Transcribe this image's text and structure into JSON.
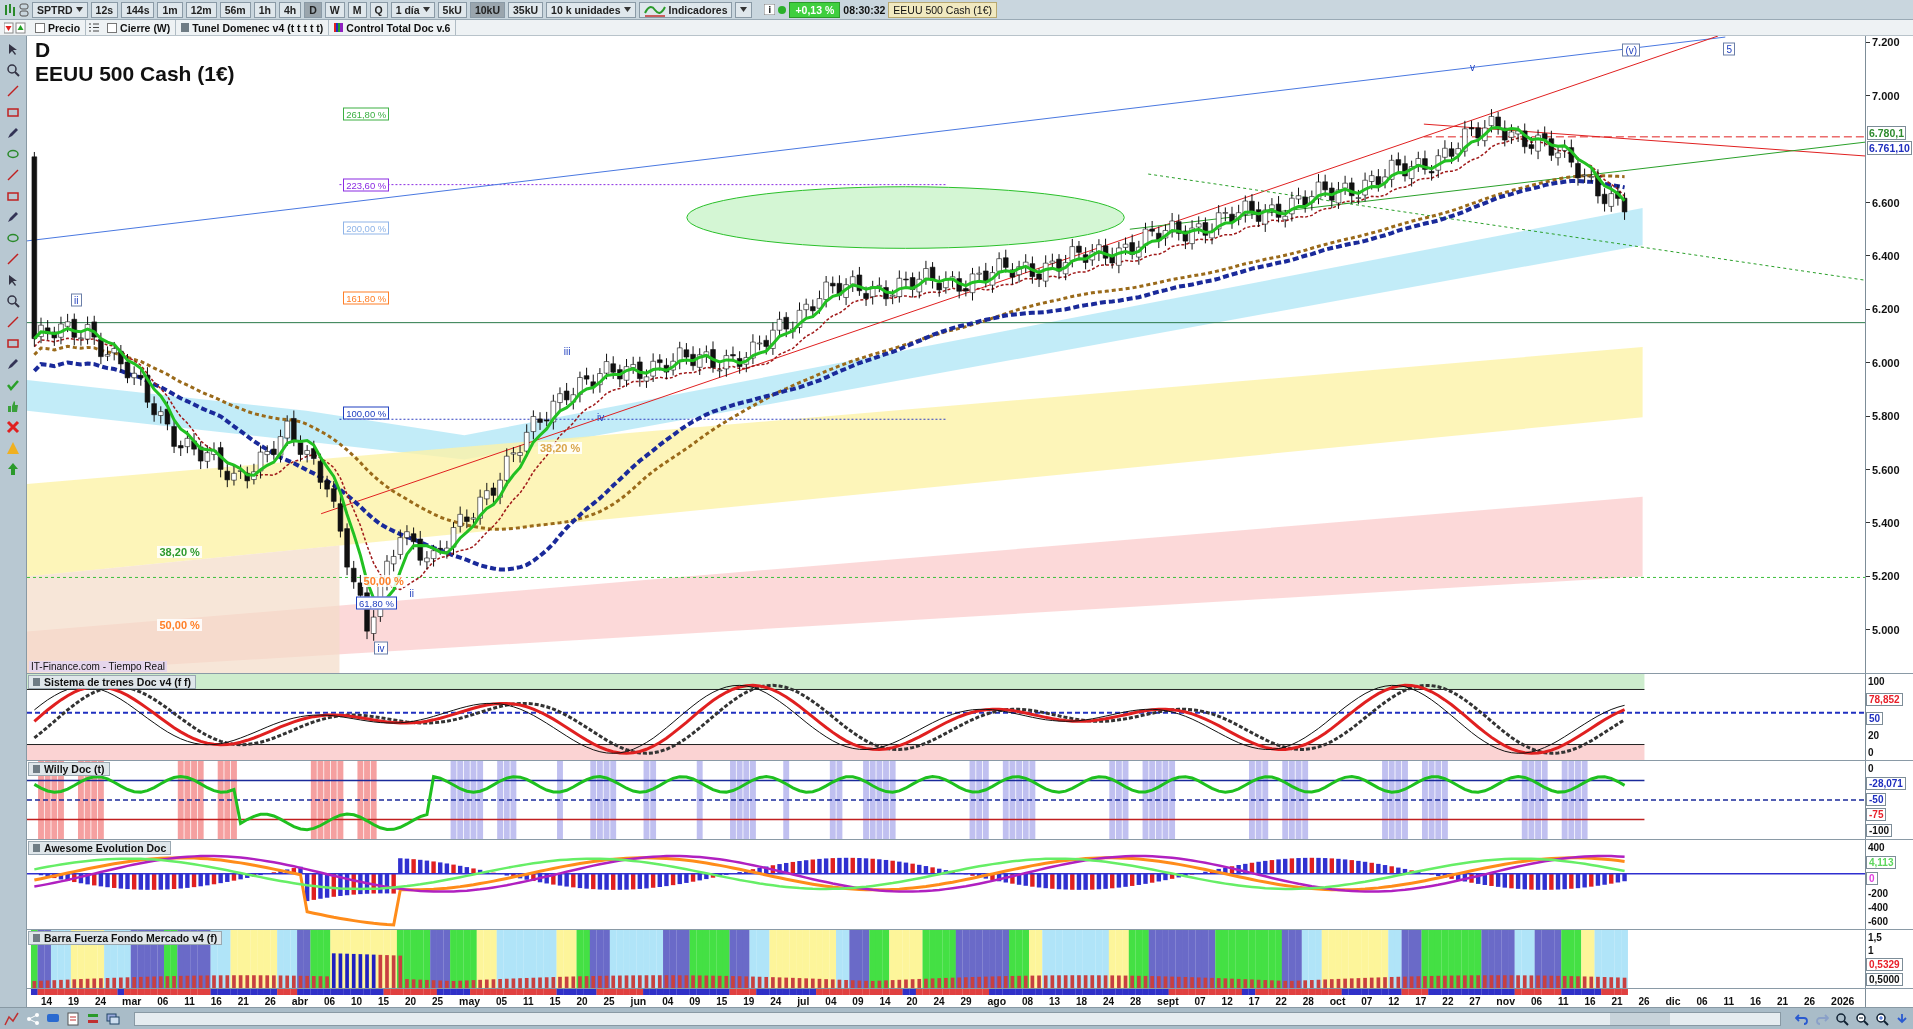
{
  "toolbar": {
    "symbol": "SPTRD",
    "timeframes": [
      {
        "label": "12s",
        "selected": false
      },
      {
        "label": "144s",
        "selected": false
      },
      {
        "label": "1m",
        "selected": false
      },
      {
        "label": "12m",
        "selected": false
      },
      {
        "label": "56m",
        "selected": false
      },
      {
        "label": "1h",
        "selected": false
      },
      {
        "label": "4h",
        "selected": false
      },
      {
        "label": "D",
        "selected": true
      },
      {
        "label": "W",
        "selected": false
      },
      {
        "label": "M",
        "selected": false
      },
      {
        "label": "Q",
        "selected": false
      }
    ],
    "period": "1 día",
    "units": [
      {
        "label": "5kU",
        "selected": false
      },
      {
        "label": "10kU",
        "selected": true
      },
      {
        "label": "35kU",
        "selected": false
      }
    ],
    "units_select": "10 k unidades",
    "indicators_button": "Indicadores",
    "change": "+0,13 %",
    "time": "08:30:32",
    "instrument": "EEUU 500 Cash (1€)"
  },
  "legend": [
    {
      "kind": "checkbox",
      "label": "Precio",
      "checked": false
    },
    {
      "kind": "checkbox",
      "label": "Cierre (W)",
      "checked": false
    },
    {
      "kind": "swatch",
      "label": "Tunel Domenec v4 (t t t t t)"
    },
    {
      "kind": "multicolor",
      "label": "Control Total Doc v.6"
    }
  ],
  "main_chart": {
    "timeframe_label": "D",
    "title": "EEUU 500 Cash (1€)",
    "source": "IT-Finance.com - Tiempo Real",
    "fib_labels": [
      {
        "text": "261,80 %",
        "color": "#3cb043",
        "boxed": true
      },
      {
        "text": "223,60 %",
        "color": "#8a2be2",
        "boxed": true
      },
      {
        "text": "200,00 %",
        "color": "#8fb4e8",
        "boxed": true
      },
      {
        "text": "161,80 %",
        "color": "#ff7f27",
        "boxed": true
      },
      {
        "text": "100,00 %",
        "color": "#1f3fbf",
        "boxed": true
      },
      {
        "text": "61,80 %",
        "color": "#1f3fbf",
        "boxed": true
      },
      {
        "text": "38,20 %",
        "color": "#2e9a2e",
        "boxed": false
      },
      {
        "text": "50,00 %",
        "color": "#ff7f27",
        "boxed": false
      },
      {
        "text": "50,00 %",
        "color": "#ff7f27",
        "boxed": false
      },
      {
        "text": "38,20 %",
        "color": "#d9a54a",
        "boxed": false
      }
    ],
    "wave_labels": [
      {
        "text": "ii",
        "boxed": true
      },
      {
        "text": "iii",
        "boxed": false
      },
      {
        "text": "iv",
        "boxed": false
      },
      {
        "text": "iv",
        "boxed": true
      },
      {
        "text": "ii",
        "boxed": false
      },
      {
        "text": "v",
        "boxed": false
      },
      {
        "text": "(v)",
        "boxed": true
      },
      {
        "text": "5",
        "boxed": true
      }
    ],
    "price_axis": [
      "7.200",
      "7.000",
      "6.600",
      "6.400",
      "6.200",
      "6.000",
      "5.800",
      "5.600",
      "5.400",
      "5.200",
      "5.000"
    ],
    "price_tags": [
      {
        "text": "6.780,1",
        "color": "#2e8b2e"
      },
      {
        "text": "6.761,10",
        "color": "#1f2fbf"
      }
    ]
  },
  "indicators": [
    {
      "kind": "trains",
      "title": "Sistema de trenes Doc v4 (f f)",
      "axis": [
        {
          "text": "100"
        },
        {
          "text": "78,852",
          "color": "#e8202a"
        },
        {
          "text": "50",
          "color": "#1f2fbf"
        },
        {
          "text": "20"
        },
        {
          "text": "0"
        }
      ]
    },
    {
      "kind": "willy",
      "title": "Willy Doc (t)",
      "axis": [
        {
          "text": "0"
        },
        {
          "text": "-28,071",
          "color": "#1f2fbf"
        },
        {
          "text": "-50",
          "color": "#1f2fbf"
        },
        {
          "text": "-75",
          "color": "#e8202a"
        },
        {
          "text": "-100",
          "color": "#111111"
        }
      ]
    },
    {
      "kind": "awesome",
      "title": "Awesome Evolution Doc",
      "axis": [
        {
          "text": "400"
        },
        {
          "text": "4,113",
          "color": "#5cd65c"
        },
        {
          "text": "0",
          "color": "#e040e0"
        },
        {
          "text": "-200"
        },
        {
          "text": "-400"
        },
        {
          "text": "-600"
        }
      ]
    },
    {
      "kind": "strength",
      "title": "Barra Fuerza Fondo Mercado v4 (f)",
      "axis": [
        {
          "text": "1,5"
        },
        {
          "text": "1"
        },
        {
          "text": "0,5329",
          "color": "#e8202a"
        },
        {
          "text": "0,5000",
          "color": "#111111"
        }
      ]
    }
  ],
  "date_axis": [
    {
      "text": "14",
      "kind": "day"
    },
    {
      "text": "19",
      "kind": "day"
    },
    {
      "text": "24",
      "kind": "day"
    },
    {
      "text": "mar",
      "kind": "month"
    },
    {
      "text": "06",
      "kind": "day"
    },
    {
      "text": "11",
      "kind": "day"
    },
    {
      "text": "16",
      "kind": "day"
    },
    {
      "text": "21",
      "kind": "day"
    },
    {
      "text": "26",
      "kind": "day"
    },
    {
      "text": "abr",
      "kind": "month"
    },
    {
      "text": "06",
      "kind": "day"
    },
    {
      "text": "10",
      "kind": "day"
    },
    {
      "text": "15",
      "kind": "day"
    },
    {
      "text": "20",
      "kind": "day"
    },
    {
      "text": "25",
      "kind": "day"
    },
    {
      "text": "may",
      "kind": "month"
    },
    {
      "text": "05",
      "kind": "day"
    },
    {
      "text": "11",
      "kind": "day"
    },
    {
      "text": "15",
      "kind": "day"
    },
    {
      "text": "20",
      "kind": "day"
    },
    {
      "text": "25",
      "kind": "day"
    },
    {
      "text": "jun",
      "kind": "month"
    },
    {
      "text": "04",
      "kind": "day"
    },
    {
      "text": "09",
      "kind": "day"
    },
    {
      "text": "15",
      "kind": "day"
    },
    {
      "text": "19",
      "kind": "day"
    },
    {
      "text": "24",
      "kind": "day"
    },
    {
      "text": "jul",
      "kind": "month"
    },
    {
      "text": "04",
      "kind": "day"
    },
    {
      "text": "09",
      "kind": "day"
    },
    {
      "text": "14",
      "kind": "day"
    },
    {
      "text": "20",
      "kind": "day"
    },
    {
      "text": "24",
      "kind": "day"
    },
    {
      "text": "29",
      "kind": "day"
    },
    {
      "text": "ago",
      "kind": "month"
    },
    {
      "text": "08",
      "kind": "day"
    },
    {
      "text": "13",
      "kind": "day"
    },
    {
      "text": "18",
      "kind": "day"
    },
    {
      "text": "24",
      "kind": "day"
    },
    {
      "text": "28",
      "kind": "day"
    },
    {
      "text": "sept",
      "kind": "month"
    },
    {
      "text": "07",
      "kind": "day"
    },
    {
      "text": "12",
      "kind": "day"
    },
    {
      "text": "17",
      "kind": "day"
    },
    {
      "text": "22",
      "kind": "day"
    },
    {
      "text": "28",
      "kind": "day"
    },
    {
      "text": "oct",
      "kind": "month"
    },
    {
      "text": "07",
      "kind": "day"
    },
    {
      "text": "12",
      "kind": "day"
    },
    {
      "text": "17",
      "kind": "day"
    },
    {
      "text": "22",
      "kind": "day"
    },
    {
      "text": "27",
      "kind": "day"
    },
    {
      "text": "nov",
      "kind": "month"
    },
    {
      "text": "06",
      "kind": "day"
    },
    {
      "text": "11",
      "kind": "day"
    },
    {
      "text": "16",
      "kind": "day"
    },
    {
      "text": "21",
      "kind": "day"
    },
    {
      "text": "26",
      "kind": "day"
    },
    {
      "text": "dic",
      "kind": "month"
    },
    {
      "text": "06",
      "kind": "day"
    },
    {
      "text": "11",
      "kind": "day"
    },
    {
      "text": "16",
      "kind": "day"
    },
    {
      "text": "21",
      "kind": "day"
    },
    {
      "text": "26",
      "kind": "day"
    },
    {
      "text": "2026",
      "kind": "month"
    }
  ]
}
